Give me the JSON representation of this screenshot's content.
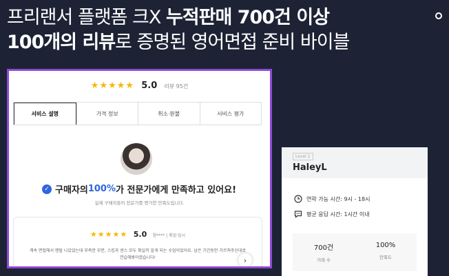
{
  "headline": {
    "line1_normal": "프리랜서 플랫폼 크X ",
    "line1_bold": "누적판매 700건 이상",
    "line2_bold": "100개의 리뷰",
    "line2_normal": "로 증명된 영어면접 준비 바이블"
  },
  "service_card": {
    "stars": "★★★★★",
    "score": "5.0",
    "review_count": "리뷰 95건",
    "tabs": [
      "서비스 설명",
      "가격 정보",
      "취소·환불",
      "서비스 평가"
    ],
    "satisfaction": {
      "prefix": "구매자의 ",
      "percent": "100%",
      "suffix": "가 전문가에게 만족하고 있어요!",
      "sub": "실제 구매자들이 전문가를 평가한 만족도입니다."
    },
    "review": {
      "stars": "★★★★★",
      "score": "5.0",
      "meta": "참****  |  취업·입시",
      "text": "계속 면접해서 멘탈 나갔었는데 부족한 부분, 스킵과 센스 모두 확실히 알게 되는 수업이었어요. 남은 기간동안 가르쳐주신대로 연습해봐야겠습니다!",
      "next_icon": "chevron-right-icon"
    }
  },
  "seller_card": {
    "level": "Level 2",
    "name": "HaleyL",
    "contact_time": "연락 가능 시간: 9시 - 18시",
    "response_time": "평균 응답 시간: 1시간 이내",
    "stats": [
      {
        "value": "700건",
        "label": "거래 수"
      },
      {
        "value": "100%",
        "label": "만족도"
      }
    ]
  },
  "colors": {
    "background": "#1d2335",
    "accent_border": "#8e49d6",
    "star": "#f6b800",
    "blue": "#2f66e0"
  }
}
